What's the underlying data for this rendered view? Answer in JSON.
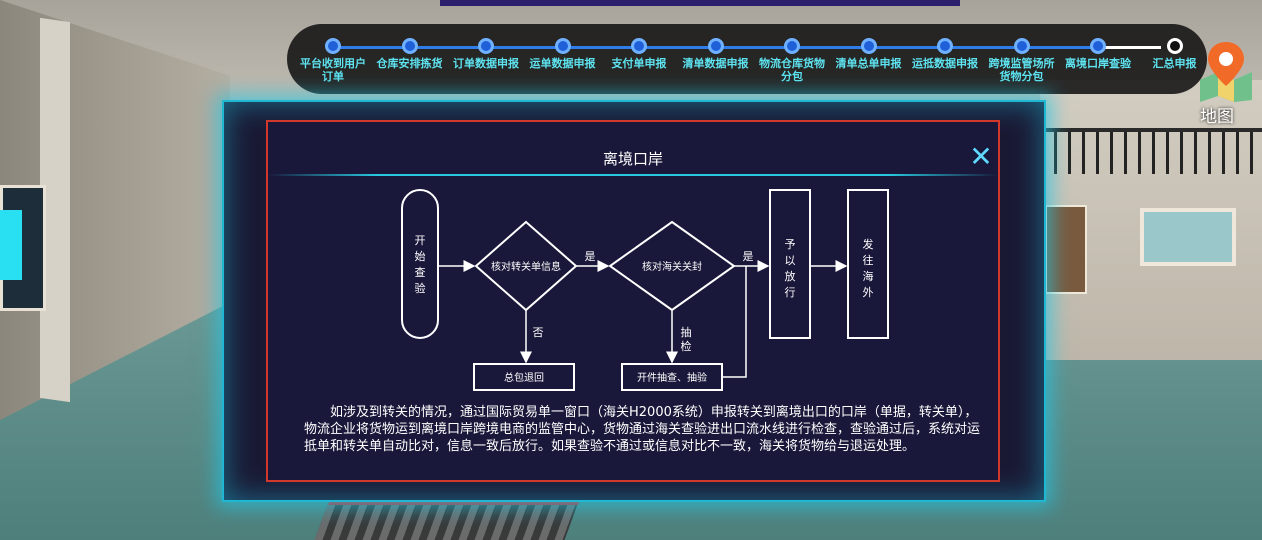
{
  "timeline": {
    "steps": [
      {
        "label": "平台收到用户订单"
      },
      {
        "label": "仓库安排拣货"
      },
      {
        "label": "订单数据申报"
      },
      {
        "label": "运单数据申报"
      },
      {
        "label": "支付单申报"
      },
      {
        "label": "清单数据申报"
      },
      {
        "label": "物流仓库货物分包"
      },
      {
        "label": "清单总单申报"
      },
      {
        "label": "运抵数据申报"
      },
      {
        "label": "跨境监管场所货物分包"
      },
      {
        "label": "离境口岸查验"
      },
      {
        "label": "汇总申报"
      }
    ],
    "current_index": 11
  },
  "map": {
    "label": "地图",
    "icon": "map-pin-icon"
  },
  "modal": {
    "title": "离境口岸",
    "close_icon": "close-icon",
    "flow": {
      "start": "开始查验",
      "diamond1": "核对转关单信息",
      "diamond2": "核对海关关封",
      "yes1": "是",
      "yes2": "是",
      "no": "否",
      "inspect": "抽检",
      "return_box": "总包退回",
      "check_box": "开件抽查、抽验",
      "release": "予以放行",
      "ship": "发往海外"
    },
    "description": "如涉及到转关的情况，通过国际贸易单一窗口（海关H2000系统）申报转关到离境出口的口岸（单据，转关单），物流企业将货物运到离境口岸跨境电商的监管中心，货物通过海关查验进出口流水线进行检查，查验通过后，系统对运抵单和转关单自动比对，信息一致后放行。如果查验不通过或信息对比不一致，海关将货物给与退运处理。"
  },
  "colors": {
    "accent": "#1fb7d1",
    "border_red": "#d1372b",
    "timeline_blue": "#2f7de9",
    "label_cyan": "#5ee3f0"
  }
}
